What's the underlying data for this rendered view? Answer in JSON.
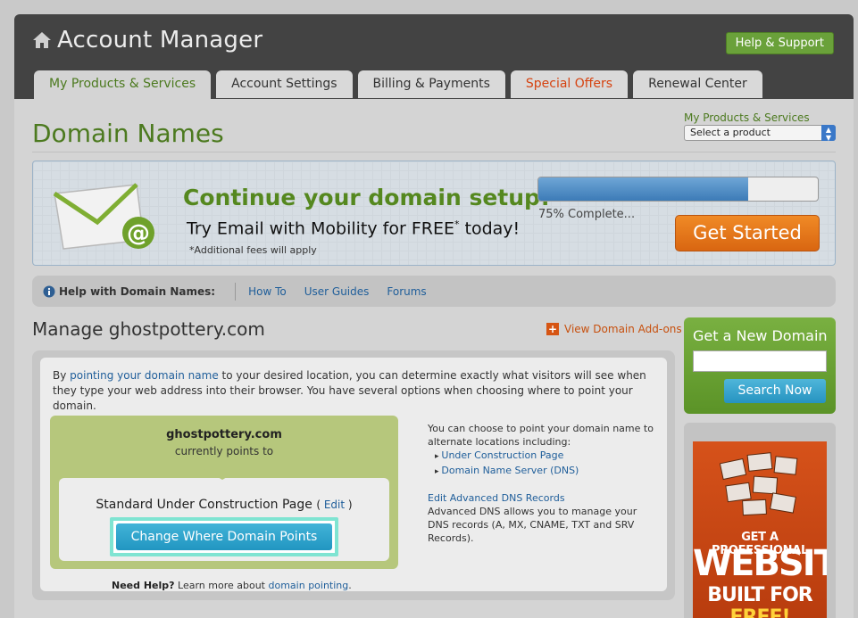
{
  "header": {
    "title": "Account Manager",
    "help_label": "Help & Support"
  },
  "tabs": [
    {
      "label": "My Products & Services"
    },
    {
      "label": "Account Settings"
    },
    {
      "label": "Billing & Payments"
    },
    {
      "label": "Special Offers"
    },
    {
      "label": "Renewal Center"
    }
  ],
  "page": {
    "title": "Domain Names",
    "product_select_label": "My Products & Services",
    "product_select_value": "Select a product"
  },
  "banner": {
    "headline": "Continue your domain setup!",
    "subline": "Try Email with Mobility for FREE",
    "subline_mark": "*",
    "subline_end": " today!",
    "note": "*Additional fees will apply",
    "progress": 0.75,
    "progress_text": "75% Complete...",
    "cta_label": "Get Started",
    "colors": {
      "headline": "#55881f",
      "cta": "#e8781c"
    }
  },
  "helpbar": {
    "lead": "Help with Domain Names:",
    "links": [
      "How To",
      "User Guides",
      "Forums"
    ]
  },
  "manage": {
    "title": "Manage ghostpottery.com",
    "addons_label": "View Domain Add-ons",
    "intro_a": "By ",
    "intro_link": "pointing your domain name",
    "intro_b": " to your desired location, you can determine exactly what visitors will see when they type your web address into their browser. You have several options when choosing where to point your domain.",
    "domain": "ghostpottery.com",
    "points_to": "currently points to",
    "current_target": "Standard Under Construction Page",
    "edit_label": "Edit",
    "change_button": "Change Where Domain Points",
    "alt_intro": "You can choose to point your domain name to alternate locations including:",
    "alt_options": [
      "Under Construction Page",
      "Domain Name Server (DNS)"
    ],
    "advanced_link": "Edit Advanced DNS Records",
    "advanced_desc": "Advanced DNS allows you to manage your DNS records (A, MX, CNAME, TXT and SRV Records).",
    "need_help_bold": "Need Help?",
    "need_help_text": " Learn more about ",
    "need_help_link": "domain pointing",
    "need_help_end": "."
  },
  "sidebar": {
    "new_domain_title": "Get a New Domain",
    "search_placeholder": "",
    "search_button": "Search Now",
    "promo_line1": "GET A PROFESSIONAL",
    "promo_line2": "WEBSITE",
    "promo_line3a": "BUILT FOR ",
    "promo_line3b": "FREE!"
  }
}
